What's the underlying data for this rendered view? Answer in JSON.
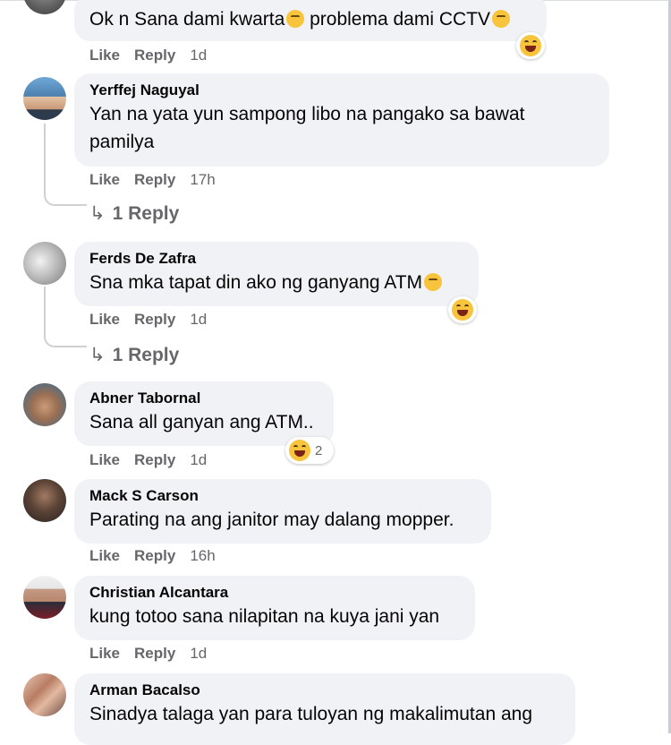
{
  "comments": [
    {
      "author": "",
      "text": "Ok n Sana dami kwarta",
      "text_after_emoji": " problema dami CCTV",
      "like": "Like",
      "reply": "Reply",
      "time": "1d",
      "reaction": "haha"
    },
    {
      "author": "Yerffej Naguyal",
      "text": "Yan na yata yun sampong libo na pangako sa bawat pamilya",
      "like": "Like",
      "reply": "Reply",
      "time": "17h",
      "replies": "1 Reply"
    },
    {
      "author": "Ferds De Zafra",
      "text": "Sna mka tapat din ako ng ganyang ATM",
      "like": "Like",
      "reply": "Reply",
      "time": "1d",
      "reaction": "haha",
      "replies": "1 Reply"
    },
    {
      "author": "Abner Tabornal",
      "text": "Sana all ganyan ang ATM..",
      "like": "Like",
      "reply": "Reply",
      "time": "1d",
      "reaction": "haha",
      "reaction_count": "2"
    },
    {
      "author": "Mack S Carson",
      "text": "Parating na ang janitor may dalang mopper.",
      "like": "Like",
      "reply": "Reply",
      "time": "16h"
    },
    {
      "author": "Christian Alcantara",
      "text": "kung totoo sana nilapitan na kuya jani yan",
      "like": "Like",
      "reply": "Reply",
      "time": "1d"
    },
    {
      "author": "Arman Bacalso",
      "text": "Sinadya talaga yan para tuloyan ng makalimutan ang"
    }
  ],
  "icons": {
    "reply_arrow": "reply-arrow-icon",
    "reaction": "haha-reaction-icon",
    "inline_emoji": "emoji-icon"
  },
  "colors": {
    "bubble": "#f0f2f5",
    "secondary_text": "#65676b",
    "reaction_yellow": "#f7c43b"
  }
}
